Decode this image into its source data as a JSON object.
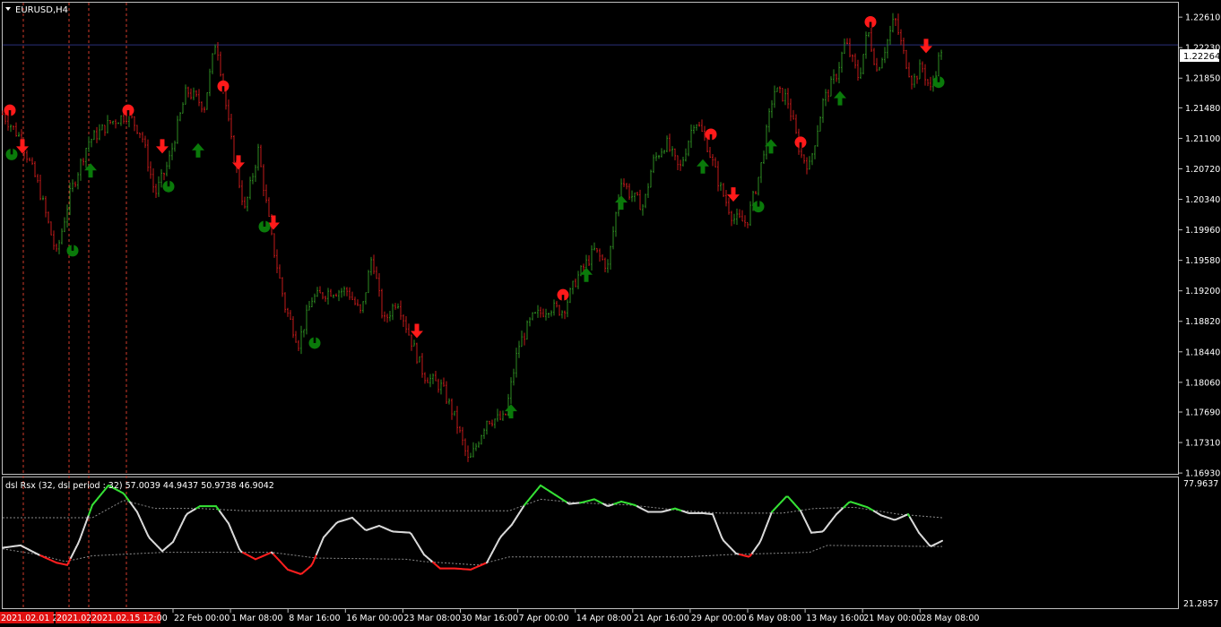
{
  "window": {
    "title": "EURUSD,H4"
  },
  "current_price": "1.22264",
  "colors": {
    "background": "#000000",
    "bull": "#2e8b22",
    "bear": "#c21a1a",
    "arrow_up": "#0a7a0a",
    "arrow_down": "#ff1a1a",
    "price_line": "#2a2f7a",
    "grid_vline": "#d03a2a",
    "rsx_neutral": "#d8d8d8",
    "rsx_up": "#35e035",
    "rsx_down": "#ff1f1f",
    "axis_text": "#ffffff",
    "tag_bg": "#e01010"
  },
  "indicator": {
    "label": "dsl Rsx (32, dsl period : 32) 57.0039 44.9437 50.9738 46.9042",
    "axis_max": "77.9637",
    "axis_min": "21.2857"
  },
  "chart_data": [
    {
      "type": "candlestick",
      "title": "EURUSD,H4",
      "ylim": [
        1.1692,
        1.2279
      ],
      "y_ticks": [
        "1.22610",
        "1.22230",
        "1.21850",
        "1.21480",
        "1.21100",
        "1.20720",
        "1.20340",
        "1.19960",
        "1.19580",
        "1.19200",
        "1.18820",
        "1.18440",
        "1.18060",
        "1.17690",
        "1.17310",
        "1.16930"
      ],
      "x_tick_labels": [
        "22 Feb 00:00",
        "1 Mar 08:00",
        "8 Mar 16:00",
        "16 Mar 00:00",
        "23 Mar 08:00",
        "30 Mar 16:00",
        "7 Apr 00:00",
        "14 Apr 08:00",
        "21 Apr 16:00",
        "29 Apr 00:00",
        "6 May 08:00",
        "13 May 16:00",
        "21 May 00:00",
        "28 May 08:00"
      ],
      "highlighted_time_labels": [
        "2021.02.01 20:00",
        "2021.02",
        "2021.02.15 12:00"
      ],
      "price_anchors": [
        [
          0,
          1.214
        ],
        [
          20,
          1.211
        ],
        [
          40,
          1.205
        ],
        [
          60,
          1.1965
        ],
        [
          75,
          1.204
        ],
        [
          95,
          1.2105
        ],
        [
          120,
          1.213
        ],
        [
          140,
          1.214
        ],
        [
          155,
          1.2115
        ],
        [
          170,
          1.204
        ],
        [
          185,
          1.208
        ],
        [
          205,
          1.217
        ],
        [
          225,
          1.215
        ],
        [
          238,
          1.2235
        ],
        [
          255,
          1.2105
        ],
        [
          270,
          1.202
        ],
        [
          285,
          1.2095
        ],
        [
          300,
          1.1985
        ],
        [
          315,
          1.19
        ],
        [
          330,
          1.1855
        ],
        [
          345,
          1.191
        ],
        [
          365,
          1.192
        ],
        [
          385,
          1.192
        ],
        [
          400,
          1.189
        ],
        [
          412,
          1.1965
        ],
        [
          425,
          1.188
        ],
        [
          440,
          1.191
        ],
        [
          455,
          1.186
        ],
        [
          470,
          1.1815
        ],
        [
          490,
          1.18
        ],
        [
          505,
          1.176
        ],
        [
          520,
          1.1705
        ],
        [
          540,
          1.176
        ],
        [
          560,
          1.176
        ],
        [
          575,
          1.185
        ],
        [
          590,
          1.1885
        ],
        [
          610,
          1.19
        ],
        [
          625,
          1.1895
        ],
        [
          640,
          1.1935
        ],
        [
          660,
          1.197
        ],
        [
          675,
          1.195
        ],
        [
          690,
          1.206
        ],
        [
          700,
          1.204
        ],
        [
          715,
          1.2025
        ],
        [
          725,
          1.208
        ],
        [
          740,
          1.2105
        ],
        [
          755,
          1.207
        ],
        [
          772,
          1.2135
        ],
        [
          785,
          1.2105
        ],
        [
          800,
          1.205
        ],
        [
          815,
          1.201
        ],
        [
          830,
          1.2005
        ],
        [
          845,
          1.207
        ],
        [
          860,
          1.217
        ],
        [
          875,
          1.216
        ],
        [
          890,
          1.209
        ],
        [
          900,
          1.2075
        ],
        [
          915,
          1.2155
        ],
        [
          930,
          1.219
        ],
        [
          940,
          1.223
        ],
        [
          955,
          1.2185
        ],
        [
          965,
          1.2245
        ],
        [
          975,
          1.2195
        ],
        [
          985,
          1.2225
        ],
        [
          995,
          1.226
        ],
        [
          1005,
          1.2215
        ],
        [
          1015,
          1.218
        ],
        [
          1025,
          1.22
        ],
        [
          1035,
          1.217
        ],
        [
          1048,
          1.2225
        ]
      ],
      "signals_up": [
        [
          98,
          1.207
        ],
        [
          218,
          1.2095
        ],
        [
          567,
          1.177
        ],
        [
          651,
          1.194
        ],
        [
          690,
          1.203
        ],
        [
          781,
          1.2075
        ],
        [
          857,
          1.21
        ],
        [
          934,
          1.216
        ]
      ],
      "signals_down": [
        [
          22,
          1.21
        ],
        [
          178,
          1.21
        ],
        [
          263,
          1.208
        ],
        [
          302,
          1.2005
        ],
        [
          462,
          1.187
        ],
        [
          815,
          1.204
        ],
        [
          1030,
          1.2225
        ]
      ],
      "circle_up": [
        [
          10,
          1.209
        ],
        [
          78,
          1.197
        ],
        [
          185,
          1.205
        ],
        [
          292,
          1.2
        ],
        [
          348,
          1.1855
        ],
        [
          843,
          1.2025
        ],
        [
          1044,
          1.218
        ]
      ],
      "circle_down": [
        [
          8,
          1.2145
        ],
        [
          140,
          1.2145
        ],
        [
          246,
          1.2175
        ],
        [
          625,
          1.1915
        ],
        [
          790,
          1.2115
        ],
        [
          890,
          1.2105
        ],
        [
          968,
          1.2255
        ]
      ]
    },
    {
      "type": "line",
      "title": "dsl Rsx (32, dsl period : 32) 57.0039 44.9437 50.9738 46.9042",
      "ylim": [
        21.2857,
        77.9637
      ],
      "series": [
        {
          "name": "rsx",
          "points": [
            [
              0,
              47.5
            ],
            [
              20,
              48.5
            ],
            [
              40,
              44.5
            ],
            [
              60,
              41.0
            ],
            [
              72,
              40.0
            ],
            [
              85,
              50.0
            ],
            [
              100,
              66.0
            ],
            [
              118,
              74.5
            ],
            [
              135,
              71.0
            ],
            [
              150,
              63.0
            ],
            [
              163,
              52.0
            ],
            [
              178,
              46.0
            ],
            [
              190,
              50.0
            ],
            [
              205,
              62.0
            ],
            [
              220,
              65.5
            ],
            [
              238,
              65.5
            ],
            [
              252,
              58.0
            ],
            [
              265,
              46.0
            ],
            [
              282,
              42.5
            ],
            [
              300,
              45.5
            ],
            [
              318,
              38.0
            ],
            [
              333,
              36.0
            ],
            [
              345,
              40.0
            ],
            [
              358,
              52.0
            ],
            [
              373,
              58.5
            ],
            [
              390,
              60.5
            ],
            [
              405,
              55.0
            ],
            [
              420,
              57.0
            ],
            [
              435,
              54.5
            ],
            [
              455,
              54.0
            ],
            [
              470,
              44.5
            ],
            [
              488,
              38.5
            ],
            [
              505,
              38.5
            ],
            [
              522,
              38.0
            ],
            [
              540,
              41.0
            ],
            [
              555,
              52.0
            ],
            [
              568,
              57.5
            ],
            [
              582,
              66.0
            ],
            [
              600,
              74.5
            ],
            [
              618,
              70.0
            ],
            [
              632,
              66.5
            ],
            [
              645,
              67.0
            ],
            [
              660,
              68.5
            ],
            [
              675,
              65.5
            ],
            [
              690,
              67.5
            ],
            [
              705,
              66.0
            ],
            [
              720,
              63.0
            ],
            [
              735,
              63.0
            ],
            [
              750,
              64.5
            ],
            [
              765,
              62.5
            ],
            [
              780,
              62.5
            ],
            [
              792,
              62.0
            ],
            [
              803,
              51.0
            ],
            [
              818,
              45.0
            ],
            [
              833,
              43.5
            ],
            [
              845,
              50.0
            ],
            [
              858,
              63.0
            ],
            [
              875,
              70.0
            ],
            [
              890,
              63.5
            ],
            [
              902,
              54.0
            ],
            [
              915,
              54.5
            ],
            [
              930,
              62.0
            ],
            [
              945,
              67.5
            ],
            [
              965,
              65.0
            ],
            [
              980,
              61.5
            ],
            [
              995,
              59.5
            ],
            [
              1010,
              62.0
            ],
            [
              1022,
              54.0
            ],
            [
              1035,
              48.0
            ],
            [
              1048,
              50.5
            ]
          ]
        },
        {
          "name": "dsl_upper",
          "points": [
            [
              0,
              60.5
            ],
            [
              60,
              60.5
            ],
            [
              100,
              60.5
            ],
            [
              135,
              68.0
            ],
            [
              170,
              64.5
            ],
            [
              220,
              64.5
            ],
            [
              270,
              63.5
            ],
            [
              340,
              63.5
            ],
            [
              440,
              63.5
            ],
            [
              520,
              63.5
            ],
            [
              565,
              63.5
            ],
            [
              600,
              68.5
            ],
            [
              640,
              67.0
            ],
            [
              700,
              66.0
            ],
            [
              760,
              63.5
            ],
            [
              800,
              62.5
            ],
            [
              870,
              62.5
            ],
            [
              905,
              64.5
            ],
            [
              950,
              65.0
            ],
            [
              1000,
              62.0
            ],
            [
              1048,
              60.5
            ]
          ]
        },
        {
          "name": "dsl_lower",
          "points": [
            [
              0,
              47.0
            ],
            [
              40,
              44.5
            ],
            [
              70,
              41.5
            ],
            [
              100,
              44.0
            ],
            [
              180,
              45.5
            ],
            [
              300,
              45.5
            ],
            [
              350,
              43.0
            ],
            [
              450,
              42.5
            ],
            [
              470,
              41.5
            ],
            [
              530,
              40.0
            ],
            [
              565,
              43.5
            ],
            [
              760,
              43.5
            ],
            [
              810,
              44.5
            ],
            [
              900,
              45.5
            ],
            [
              920,
              48.5
            ],
            [
              1048,
              48.0
            ]
          ]
        }
      ]
    }
  ]
}
